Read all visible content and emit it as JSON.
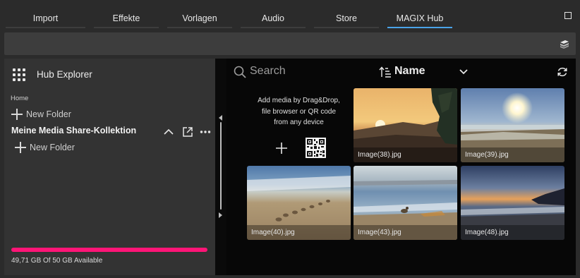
{
  "tabs": [
    {
      "label": "Import",
      "active": false
    },
    {
      "label": "Effekte",
      "active": false
    },
    {
      "label": "Vorlagen",
      "active": false
    },
    {
      "label": "Audio",
      "active": false
    },
    {
      "label": "Store",
      "active": false
    },
    {
      "label": "MAGIX Hub",
      "active": true
    }
  ],
  "sidebar": {
    "title": "Hub Explorer",
    "section_label": "Home",
    "new_folder_label": "New Folder",
    "collection": {
      "title": "Meine Media Share-Kollektion",
      "new_folder_label": "New Folder"
    },
    "storage": {
      "text": "49,71 GB Of 50 GB Available",
      "used_fraction": 0.9942
    }
  },
  "main": {
    "search_placeholder": "Search",
    "sort_label": "Name",
    "drop_zone_text": [
      "Add media by Drag&Drop,",
      "file browser or QR code",
      "from any device"
    ],
    "media": [
      {
        "name": "Image(38).jpg"
      },
      {
        "name": "Image(39).jpg"
      },
      {
        "name": "Image(40).jpg"
      },
      {
        "name": "Image(43).jpg"
      },
      {
        "name": "Image(48).jpg"
      }
    ]
  },
  "colors": {
    "accent": "#4aa3e8",
    "storage_bar": "#ff1577",
    "panel_left": "#333333",
    "panel_right": "#070707"
  },
  "icons": {
    "hub": "grid-icon",
    "search": "search-icon",
    "sort": "sort-icon",
    "refresh": "refresh-icon",
    "qr": "qr-code-icon",
    "toolbar": "stack-icon"
  }
}
